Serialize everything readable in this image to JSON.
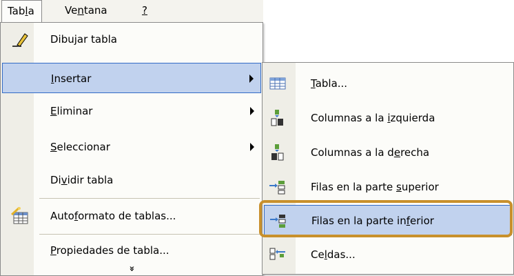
{
  "menubar": {
    "items": [
      {
        "pre": "Tab",
        "u": "l",
        "post": "a"
      },
      {
        "pre": "Ve",
        "u": "n",
        "post": "tana"
      },
      {
        "pre": "",
        "u": "?",
        "post": ""
      }
    ]
  },
  "main_menu": {
    "items": [
      {
        "pre": "Dibu",
        "u": "j",
        "post": "ar tabla",
        "icon": "pencil-icon"
      },
      {
        "pre": "",
        "u": "I",
        "post": "nsertar",
        "submenu": true
      },
      {
        "pre": "",
        "u": "E",
        "post": "liminar",
        "submenu": true
      },
      {
        "pre": "",
        "u": "S",
        "post": "eleccionar",
        "submenu": true
      },
      {
        "pre": "Di",
        "u": "v",
        "post": "idir tabla"
      },
      {
        "pre": "Auto",
        "u": "f",
        "post": "ormato de tablas...",
        "icon": "table-autoformat-icon"
      },
      {
        "pre": "",
        "u": "P",
        "post": "ropiedades de tabla..."
      }
    ],
    "expand_glyph": "»"
  },
  "submenu": {
    "items": [
      {
        "pre": "",
        "u": "T",
        "post": "abla...",
        "icon": "table-grid-icon"
      },
      {
        "pre": "Columnas a la ",
        "u": "i",
        "post": "zquierda",
        "icon": "insert-columns-left-icon"
      },
      {
        "pre": "Columnas a la d",
        "u": "e",
        "post": "recha",
        "icon": "insert-columns-right-icon"
      },
      {
        "pre": "Filas en la parte ",
        "u": "s",
        "post": "uperior",
        "icon": "insert-rows-above-icon"
      },
      {
        "pre": "Filas en la parte in",
        "u": "f",
        "post": "erior",
        "icon": "insert-rows-below-icon"
      },
      {
        "pre": "Ce",
        "u": "l",
        "post": "das...",
        "icon": "insert-cells-icon"
      }
    ]
  },
  "colors": {
    "highlight": "#c1d2ee",
    "highlight_border": "#316ac5",
    "focus_ring": "#c8902c"
  }
}
